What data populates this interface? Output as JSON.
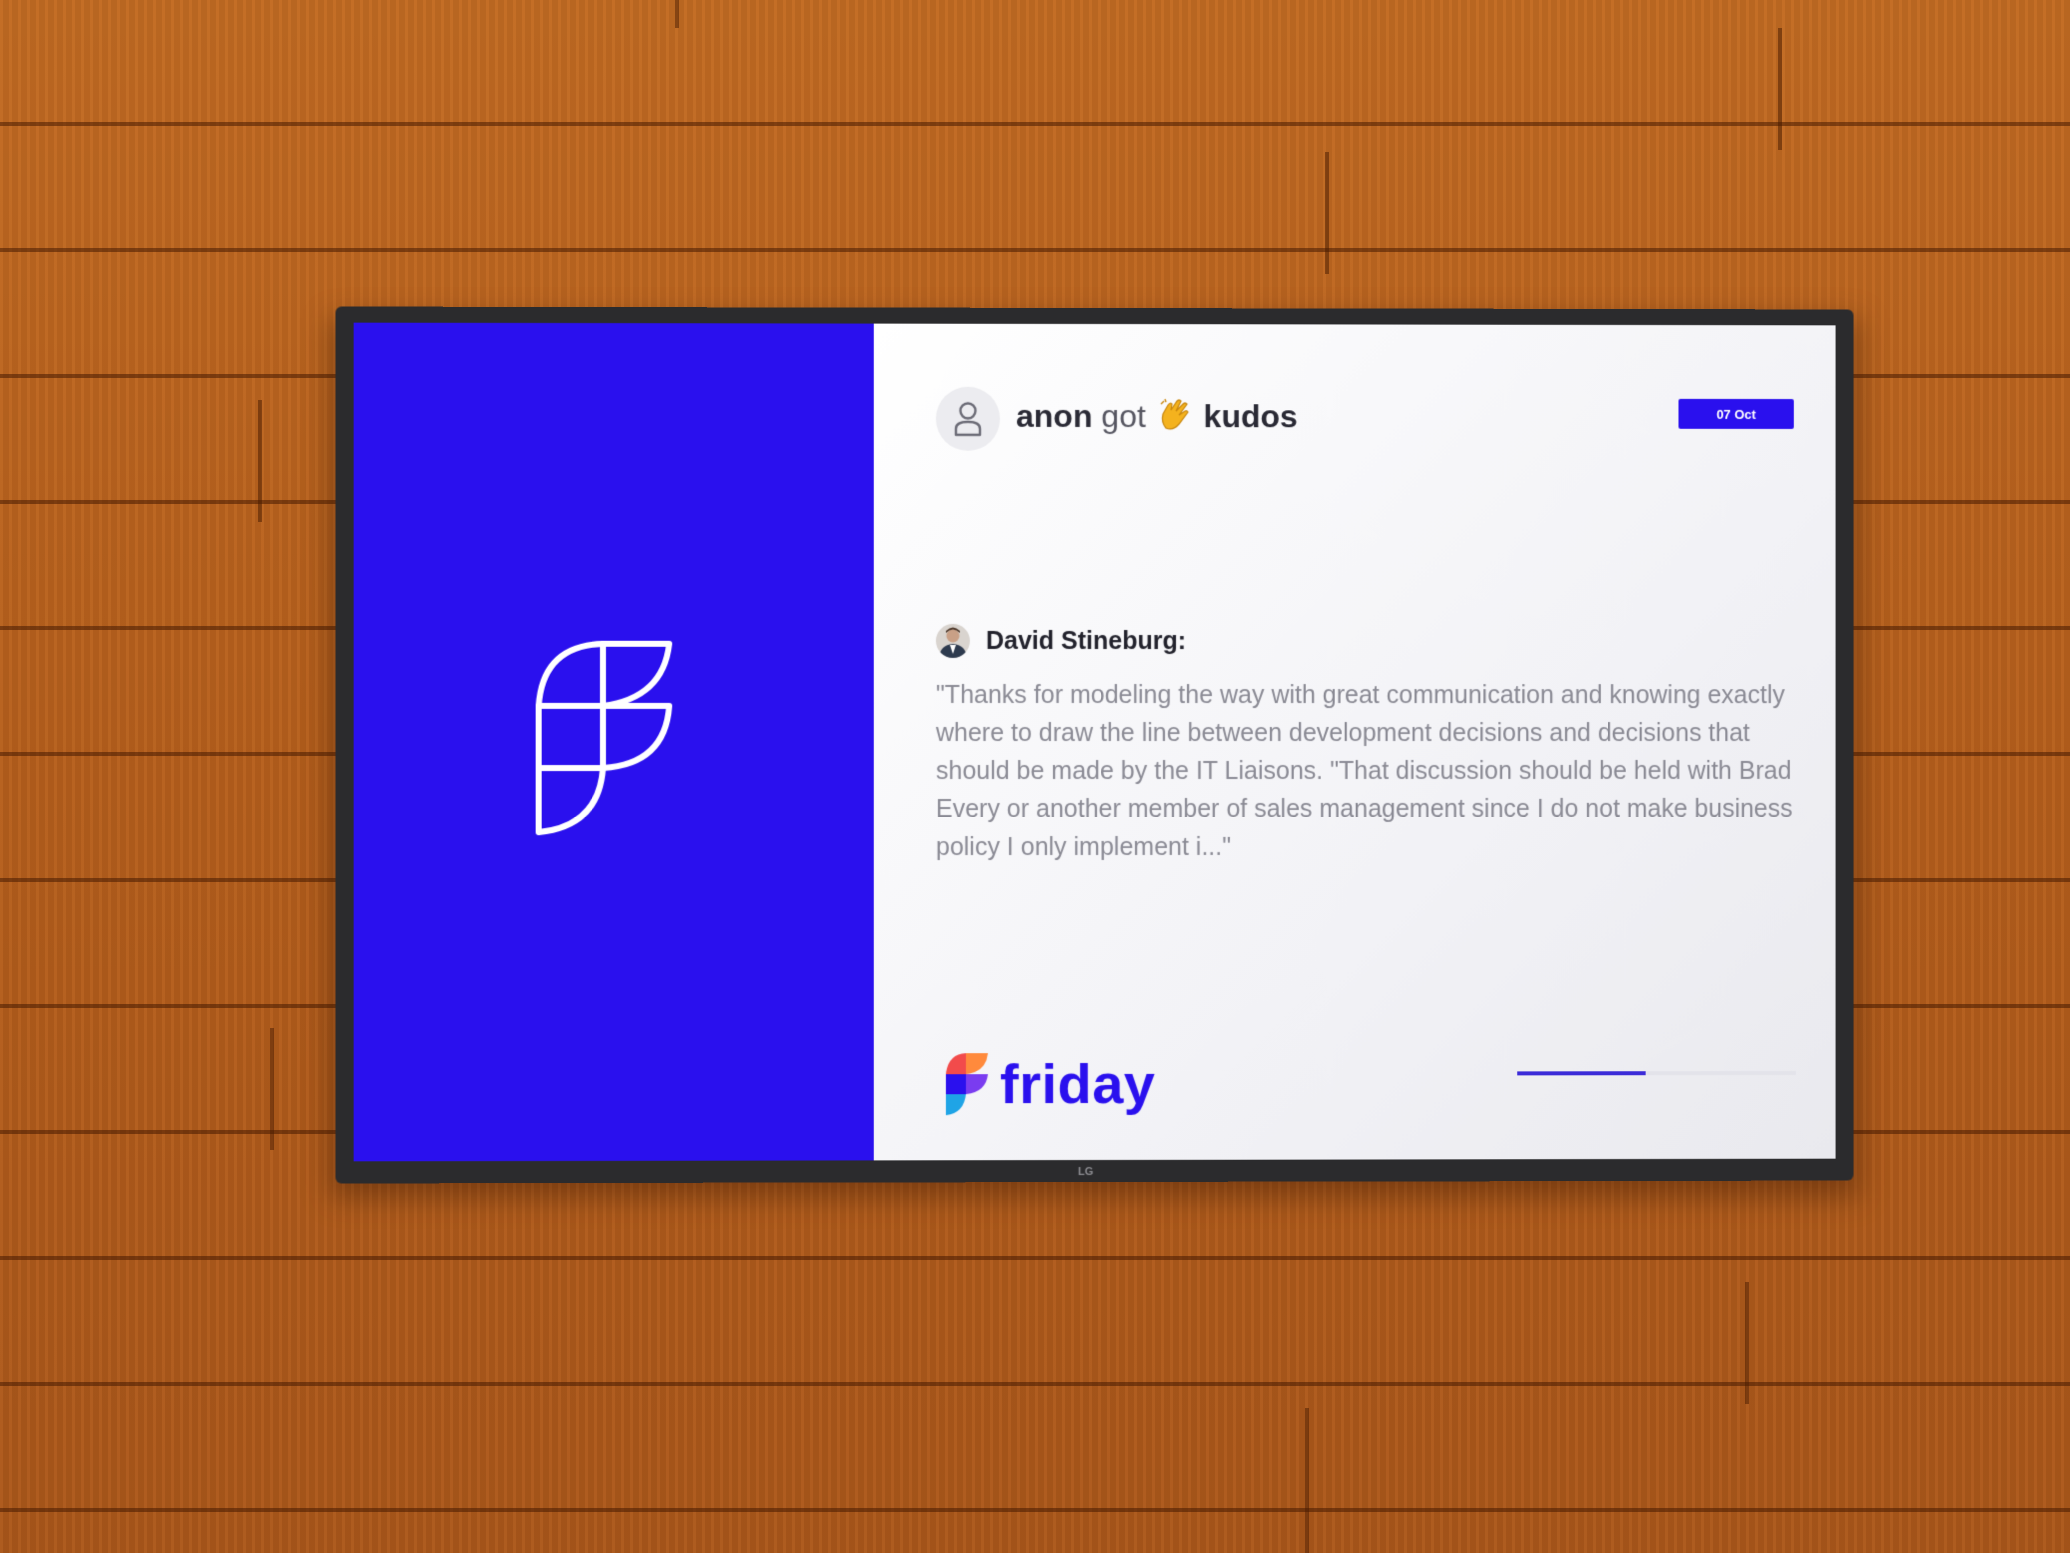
{
  "post": {
    "recipient": "anon",
    "action": "got",
    "reward": "kudos",
    "date": "07 Oct"
  },
  "message": {
    "author": "David Stineburg:",
    "quote": "\"Thanks for modeling the way with great communication and knowing exactly where to draw the line between development decisions and decisions that should be made by the IT Liaisons. \"That discussion should be held with Brad Every or another member of sales management since I do not make business policy I only implement i...\""
  },
  "brand": {
    "name": "friday"
  },
  "tv": {
    "maker": "LG"
  },
  "slideshow": {
    "progress": 0.46
  },
  "colors": {
    "accent": "#2a10ee",
    "wood": "#b8621f"
  }
}
